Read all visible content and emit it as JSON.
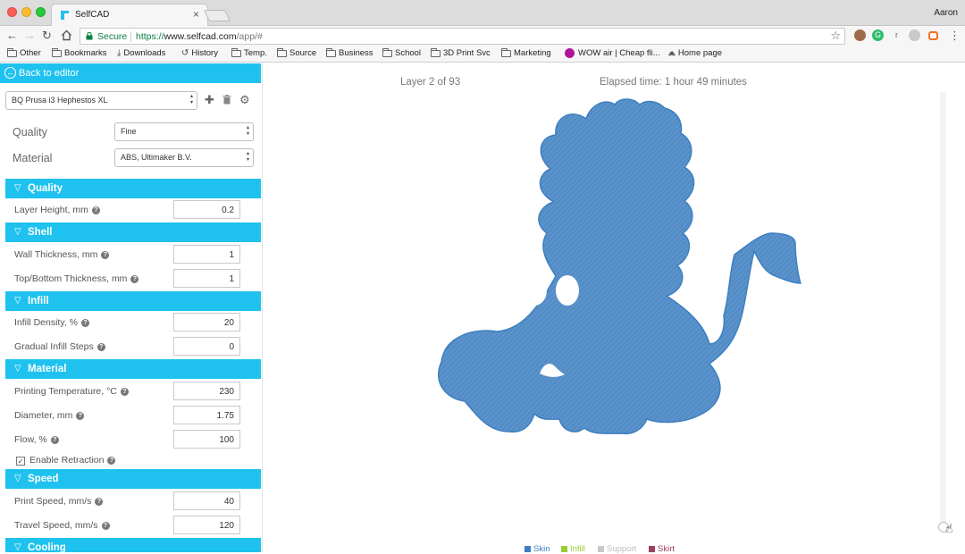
{
  "browser": {
    "tab_title": "SelfCAD",
    "tab_close": "×",
    "user": "Aaron",
    "secure_label": "Secure",
    "url_scheme": "https://",
    "url_host": "www.selfcad.com",
    "url_path": "/app/#",
    "bookmarks": [
      {
        "label": "Other",
        "icon": "folder"
      },
      {
        "label": "Bookmarks",
        "icon": "folder"
      },
      {
        "label": "Downloads",
        "icon": "download"
      },
      {
        "label": "History",
        "icon": "history"
      },
      {
        "label": "Temp.",
        "icon": "folder"
      },
      {
        "label": "Source",
        "icon": "folder"
      },
      {
        "label": "Business",
        "icon": "folder"
      },
      {
        "label": "School",
        "icon": "folder"
      },
      {
        "label": "3D Print Svc",
        "icon": "folder"
      },
      {
        "label": "Marketing",
        "icon": "folder"
      },
      {
        "label": "WOW air | Cheap fli...",
        "icon": "wow-air"
      },
      {
        "label": "Home page",
        "icon": "home-page"
      }
    ]
  },
  "sidebar": {
    "back_label": "Back to editor",
    "printer": "BQ Prusa i3 Hephestos XL",
    "quality_label": "Quality",
    "quality_value": "Fine",
    "material_label": "Material",
    "material_value": "ABS, Ultimaker B.V.",
    "sections": {
      "quality": "Quality",
      "shell": "Shell",
      "infill": "Infill",
      "material": "Material",
      "speed": "Speed",
      "cooling": "Cooling"
    },
    "fields": {
      "layer_height": {
        "label": "Layer Height, mm",
        "value": "0.2"
      },
      "wall_thickness": {
        "label": "Wall Thickness, mm",
        "value": "1"
      },
      "top_bottom": {
        "label": "Top/Bottom Thickness, mm",
        "value": "1"
      },
      "infill_density": {
        "label": "Infill Density, %",
        "value": "20"
      },
      "gradual_infill": {
        "label": "Gradual Infill Steps",
        "value": "0"
      },
      "print_temp": {
        "label": "Printing Temperature, °C",
        "value": "230"
      },
      "diameter": {
        "label": "Diameter, mm",
        "value": "1.75"
      },
      "flow": {
        "label": "Flow, %",
        "value": "100"
      },
      "retraction": {
        "label": "Enable Retraction",
        "checked": true
      },
      "print_speed": {
        "label": "Print Speed, mm/s",
        "value": "40"
      },
      "travel_speed": {
        "label": "Travel Speed, mm/s",
        "value": "120"
      }
    }
  },
  "viewer": {
    "layer_text": "Layer 2 of 93",
    "elapsed_text": "Elapsed time: 1 hour 49 minutes",
    "legend": [
      {
        "label": "Skin",
        "color": "#3d7fc1"
      },
      {
        "label": "Infill",
        "color": "#9acd32"
      },
      {
        "label": "Support",
        "color": "#c8c8c8"
      },
      {
        "label": "Skirt",
        "color": "#a04060"
      }
    ]
  },
  "colors": {
    "accent": "#1fc2ee",
    "model_fill": "#5a93cb",
    "model_stroke": "#3d7fc1"
  }
}
